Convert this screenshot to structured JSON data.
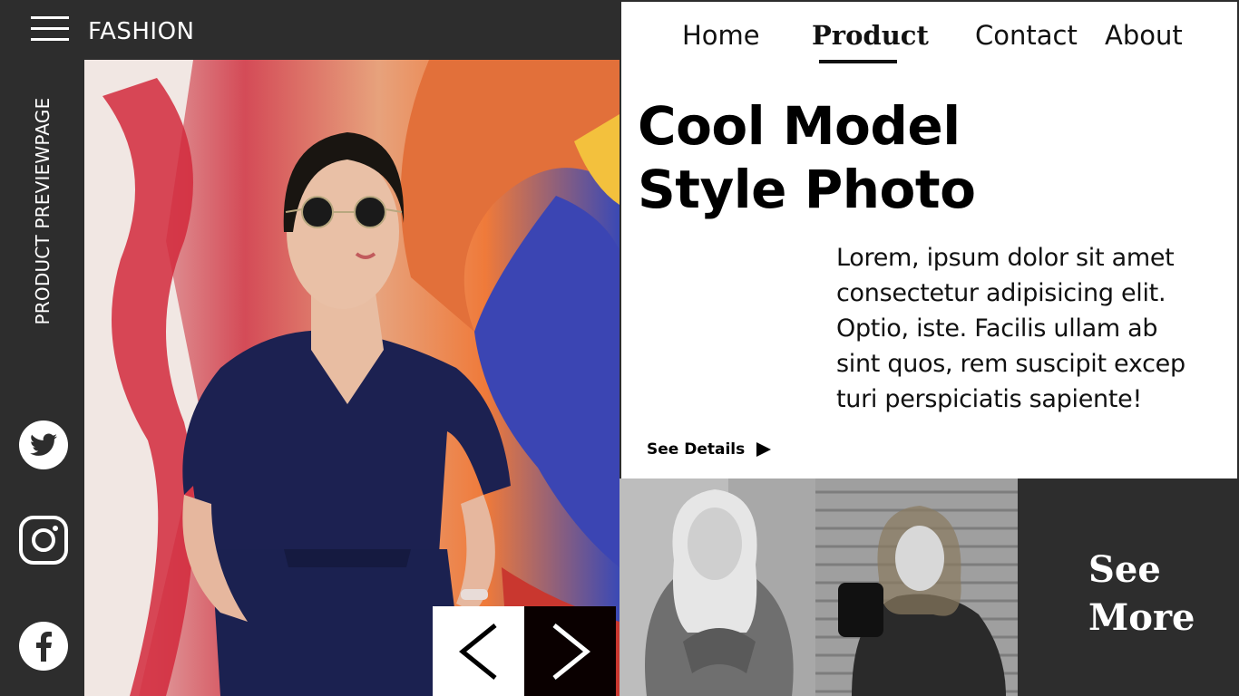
{
  "brand": {
    "name": "FASHION"
  },
  "sidebar": {
    "vertical_label": "PRODUCT PREVIEWPAGE",
    "social": [
      "twitter-icon",
      "instagram-icon",
      "facebook-icon"
    ]
  },
  "nav": {
    "items": [
      "Home",
      "Product",
      "Contact",
      "About"
    ],
    "active": "Product"
  },
  "hero": {
    "title_line1": "Cool Model",
    "title_line2": "Style Photo",
    "description": "Lorem, ipsum dolor sit amet consectetur adipisicing elit. Optio, iste. Facilis ullam ab sint quos, rem suscipit excep turi perspiciatis sapiente!",
    "cta": "See Details"
  },
  "gallery": {
    "see_more_line1": "See",
    "see_more_line2": "More"
  },
  "colors": {
    "dark": "#2d2d2d",
    "white": "#ffffff",
    "accent_black": "#0a0000"
  }
}
